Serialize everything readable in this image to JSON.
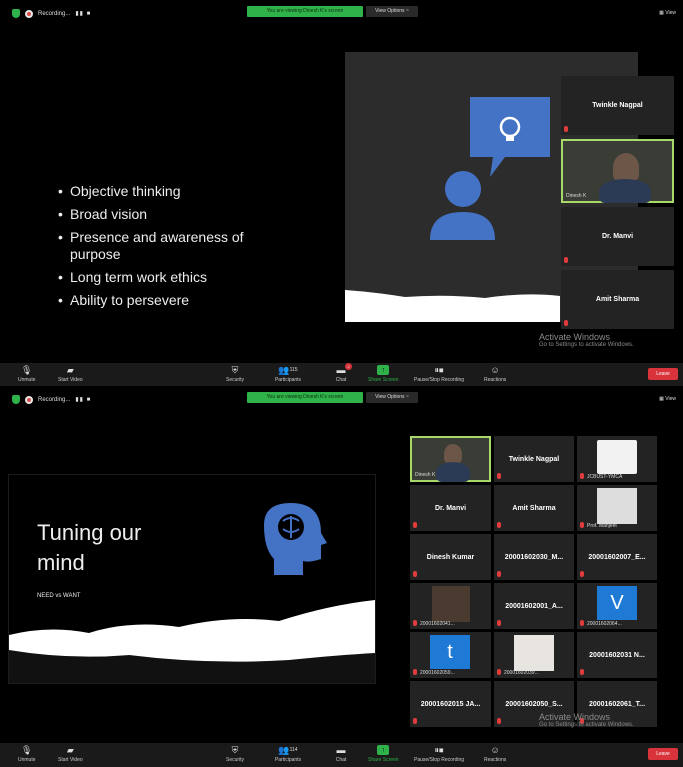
{
  "top": {
    "recording": "Recording...",
    "viewing": "You are viewing Dinesh K's screen",
    "view_options": "View Options ~",
    "view": "View"
  },
  "slide1": {
    "bullets": [
      "Objective thinking",
      "Broad vision",
      "Presence and awareness  of purpose",
      "Long term work ethics",
      "Ability to persevere"
    ]
  },
  "gallery1": [
    {
      "label": "Twinkle Nagpal"
    },
    {
      "label": "Dinesh K"
    },
    {
      "label": "Dr. Manvi"
    },
    {
      "label": "Amit Sharma"
    }
  ],
  "watermark": {
    "title": "Activate Windows",
    "sub": "Go to Settings to activate Windows."
  },
  "controls1": {
    "unmute": "Unmute",
    "start_video": "Start Video",
    "security": "Security",
    "participants": "Participants",
    "participants_count": "115",
    "chat": "Chat",
    "share": "Share Screen",
    "pause": "Pause/Stop Recording",
    "reactions": "Reactions",
    "leave": "Leave",
    "chat_badge": "2"
  },
  "controls2": {
    "participants_count": "114"
  },
  "slide2": {
    "title": "Tuning our mind",
    "sub": "NEED vs WANT"
  },
  "gallery2": [
    {
      "label": "Dinesh K"
    },
    {
      "label": "Twinkle Nagpal"
    },
    {
      "label": "JCBUST-YMCA"
    },
    {
      "label": "Dr. Manvi"
    },
    {
      "label": "Amit Sharma"
    },
    {
      "label": "Prof. Manjeet"
    },
    {
      "label": "Dinesh Kumar"
    },
    {
      "label": "20001602030_M..."
    },
    {
      "label": "20001602007_E..."
    },
    {
      "label": "20001602041..."
    },
    {
      "label": "20001602001_A..."
    },
    {
      "label": "20001602064..."
    },
    {
      "label": "20001602059..."
    },
    {
      "label": "20001602039..."
    },
    {
      "label": "20001602031 N..."
    },
    {
      "label": "20001602015 JA..."
    },
    {
      "label": "20001602050_S..."
    },
    {
      "label": "20001602061_T..."
    }
  ],
  "avatars": {
    "v": "V",
    "t": "t"
  },
  "colors": {
    "accent_green": "#2fb24a",
    "leave_red": "#d9333b",
    "slide_blue": "#4472c4",
    "active_border": "#a6d96a"
  }
}
